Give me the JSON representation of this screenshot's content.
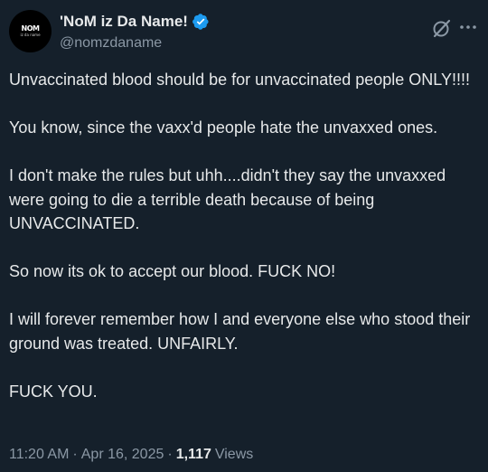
{
  "author": {
    "display_name": "'NoM iz Da Name!",
    "handle": "@nomzdaname",
    "avatar_text": "NOM",
    "avatar_subtext": "iz da name",
    "verified": true,
    "verified_color": "#1d9bf0",
    "avatar_bg": "#000000"
  },
  "header_icons": {
    "grok": "grok-slash-circle-icon",
    "more": "more-dots-icon"
  },
  "tweet": {
    "text": "Unvaccinated blood should be for unvaccinated people ONLY!!!!\n\nYou know, since the vaxx'd people hate the unvaxxed ones.\n\nI don't make the rules but uhh....didn't they say the unvaxxed were going to die a terrible death because of being UNVACCINATED.\n\nSo now its ok to accept our blood. FUCK NO!\n\nI will forever remember how I and everyone else who stood their ground was treated. UNFAIRLY.\n\nFUCK YOU."
  },
  "meta": {
    "time": "11:20 AM",
    "separator": "·",
    "date": "Apr 16, 2025",
    "views_count": "1,117",
    "views_label": "Views"
  },
  "theme": {
    "background": "#15202b",
    "text": "#e7e9ea",
    "secondary_text": "#8b98a5"
  }
}
